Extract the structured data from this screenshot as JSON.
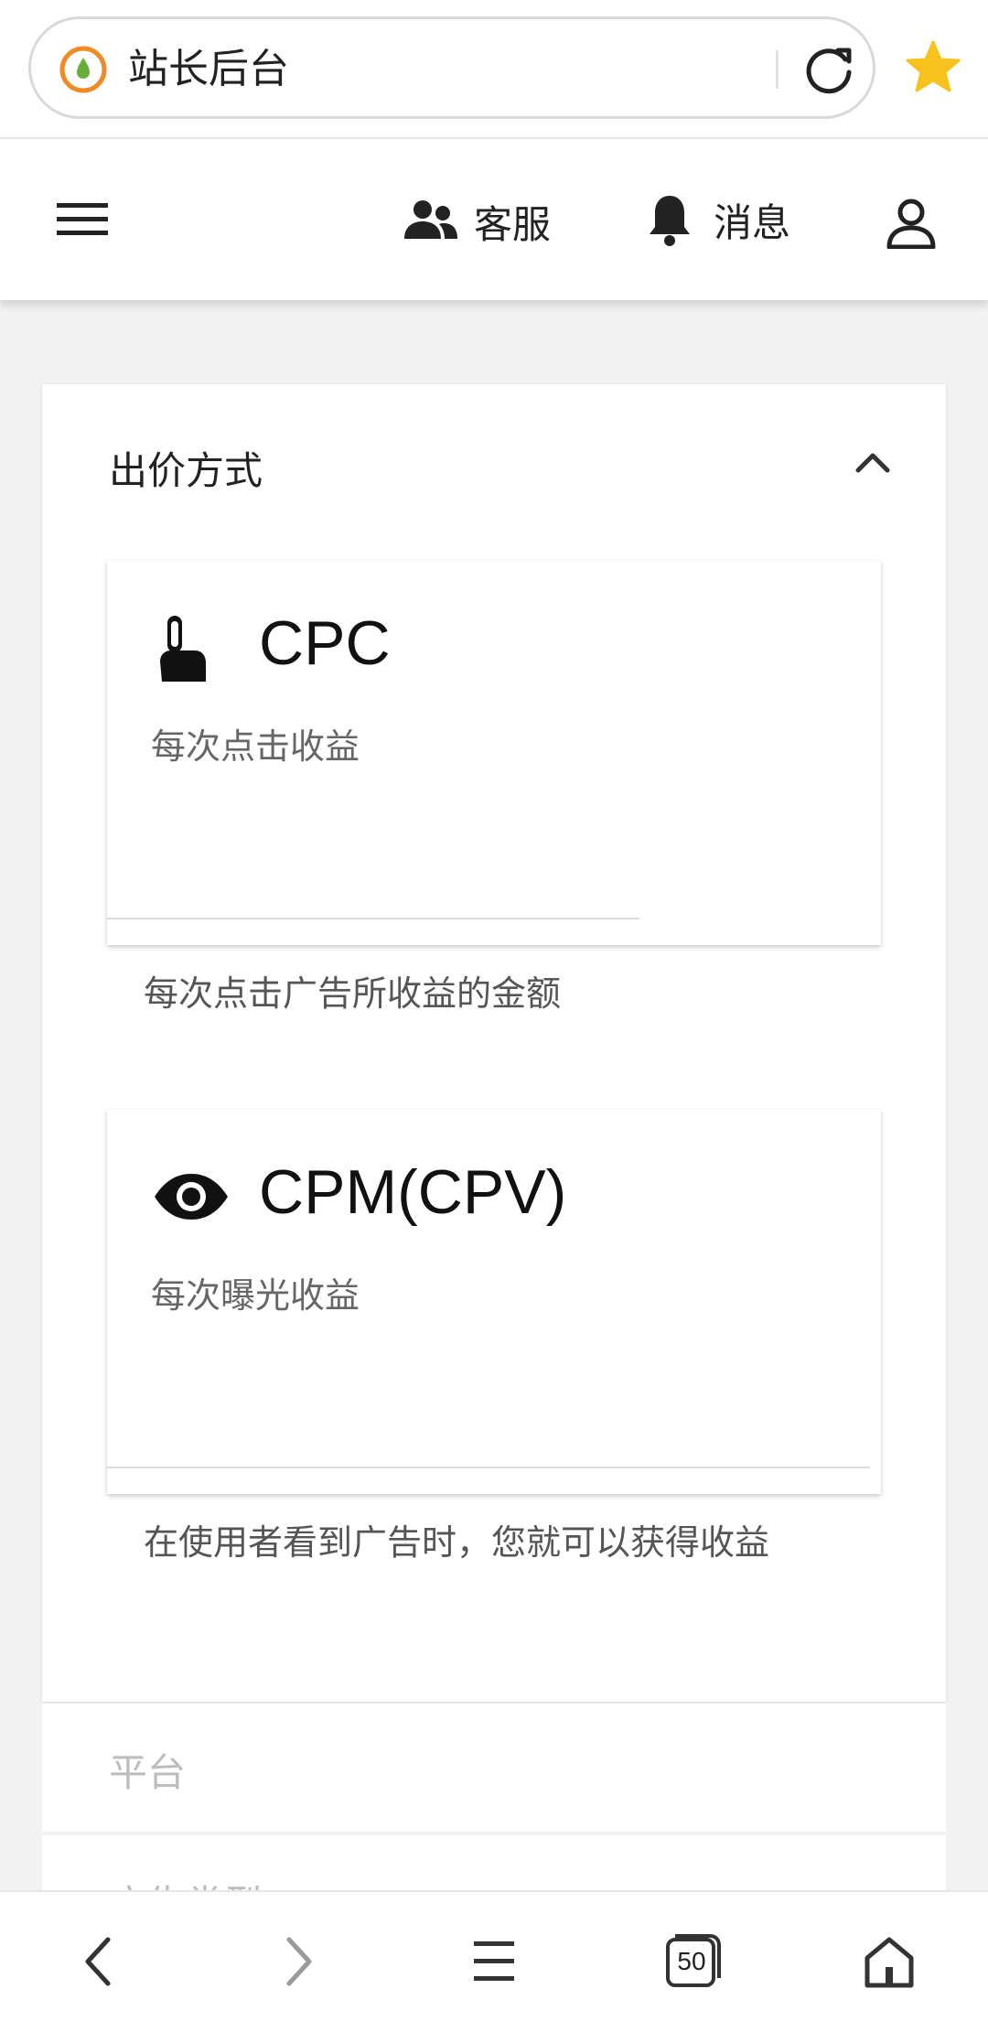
{
  "browser": {
    "site_title": "站长后台",
    "tab_count": "50"
  },
  "header": {
    "service_label": "客服",
    "notify_label": "消息"
  },
  "panel": {
    "title": "出价方式",
    "options": [
      {
        "title": "CPC",
        "subtitle": "每次点击收益",
        "description": "每次点击广告所收益的金额",
        "icon": "tap-finger-icon"
      },
      {
        "title": "CPM(CPV)",
        "subtitle": "每次曝光收益",
        "description": "在使用者看到广告时，您就可以获得收益",
        "icon": "eye-icon"
      }
    ],
    "sections": [
      "平台",
      "广告类型"
    ]
  },
  "colors": {
    "accent_star": "#f7c21e",
    "logo_orange": "#f08a24",
    "logo_green": "#6aae3a"
  }
}
